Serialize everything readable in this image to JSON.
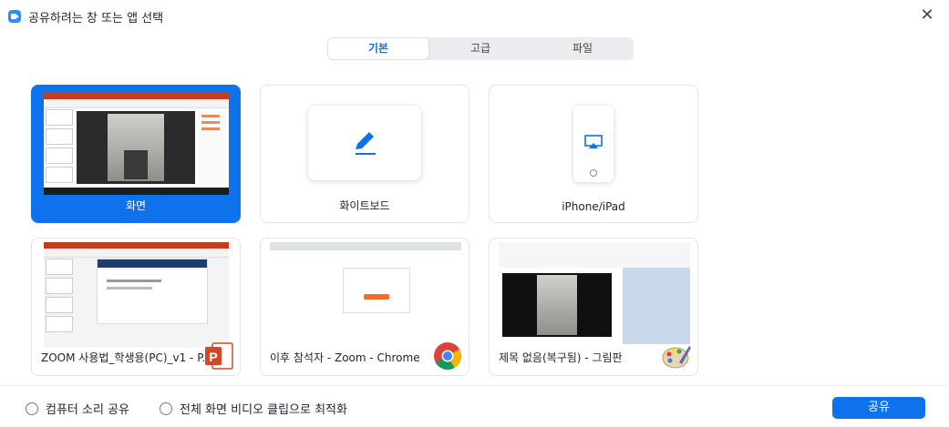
{
  "window": {
    "title": "공유하려는 창 또는 앱 선택",
    "close_glyph": "✕"
  },
  "tabs": [
    {
      "label": "기본",
      "active": true
    },
    {
      "label": "고급",
      "active": false
    },
    {
      "label": "파일",
      "active": false
    }
  ],
  "cards": {
    "screen": {
      "label": "화면",
      "selected": true
    },
    "whiteboard": {
      "label": "화이트보드"
    },
    "iphone": {
      "label": "iPhone/iPad"
    },
    "powerpoint": {
      "label": "ZOOM 사용법_학생용(PC)_v1 - P...",
      "icon": "powerpoint-icon"
    },
    "chrome": {
      "label": "이후 참석자 - Zoom - Chrome",
      "icon": "chrome-icon"
    },
    "paint": {
      "label": "제목 없음(복구됨) - 그림판",
      "icon": "paint-icon"
    }
  },
  "footer": {
    "share_sound": "컴퓨터 소리 공유",
    "optimize_video": "전체 화면 비디오 클립으로 최적화",
    "share_button": "공유"
  },
  "colors": {
    "accent": "#0E72ED",
    "powerpoint": "#D24726"
  }
}
